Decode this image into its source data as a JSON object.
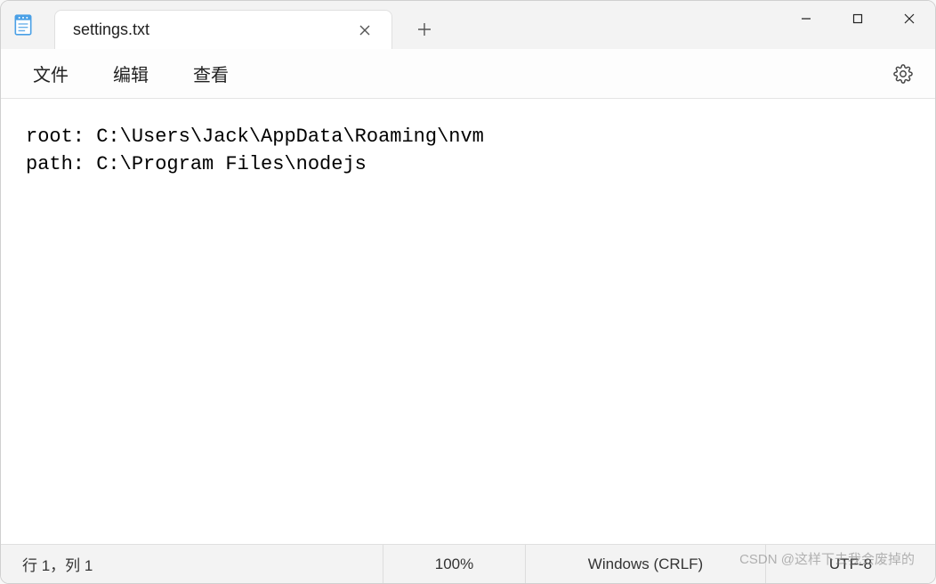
{
  "tab": {
    "title": "settings.txt"
  },
  "menu": {
    "file": "文件",
    "edit": "编辑",
    "view": "查看"
  },
  "document": {
    "text": "root: C:\\Users\\Jack\\AppData\\Roaming\\nvm\npath: C:\\Program Files\\nodejs"
  },
  "status": {
    "position": "行 1，列 1",
    "zoom": "100%",
    "eol": "Windows (CRLF)",
    "encoding": "UTF-8"
  },
  "watermark": "CSDN @这样下去我会废掉的"
}
